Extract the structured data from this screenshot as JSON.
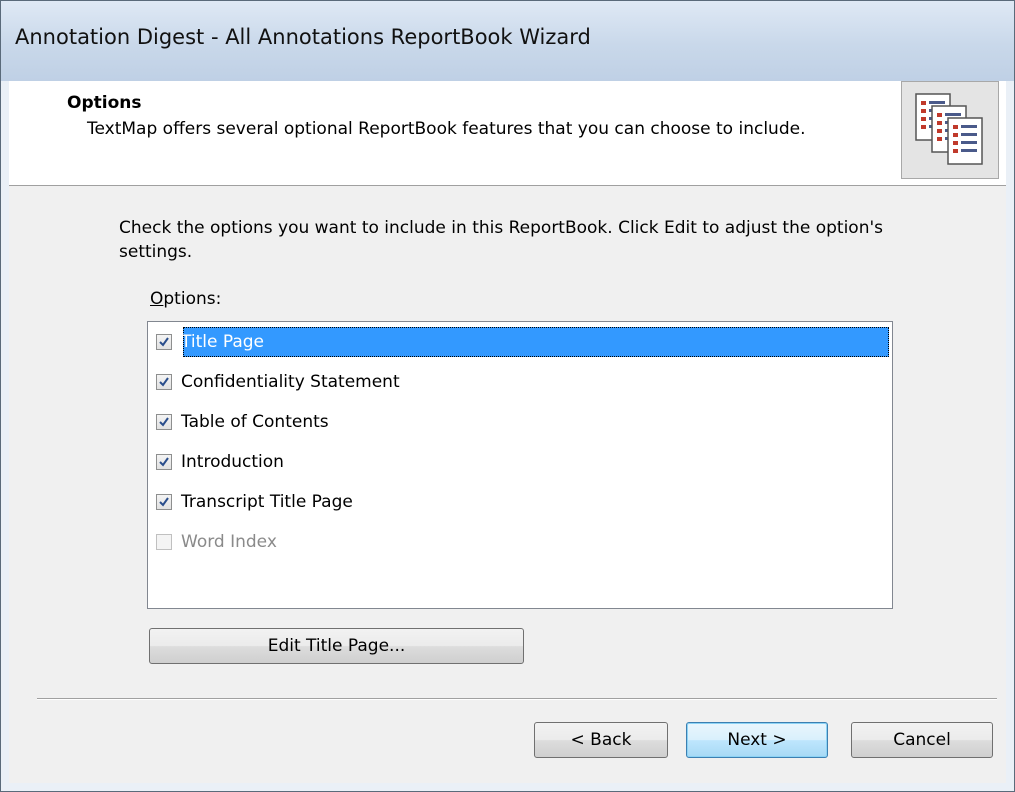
{
  "window": {
    "title": "Annotation Digest - All Annotations ReportBook Wizard"
  },
  "header": {
    "title": "Options",
    "description": "TextMap offers several optional ReportBook features that you can choose to include.",
    "icon": "reportbook-pages-icon"
  },
  "content": {
    "instructions": "Check the options you want to include in this ReportBook.  Click Edit to adjust the option's settings.",
    "options_label_accel": "O",
    "options_label_rest": "ptions:",
    "options": [
      {
        "label": "Title Page",
        "checked": true,
        "selected": true,
        "enabled": true
      },
      {
        "label": "Confidentiality Statement",
        "checked": true,
        "selected": false,
        "enabled": true
      },
      {
        "label": "Table of Contents",
        "checked": true,
        "selected": false,
        "enabled": true
      },
      {
        "label": "Introduction",
        "checked": true,
        "selected": false,
        "enabled": true
      },
      {
        "label": "Transcript Title Page",
        "checked": true,
        "selected": false,
        "enabled": true
      },
      {
        "label": "Word Index",
        "checked": false,
        "selected": false,
        "enabled": false
      }
    ],
    "edit_button_label": "Edit Title Page..."
  },
  "footer": {
    "back_label": "< Back",
    "next_label": "Next >",
    "cancel_label": "Cancel"
  },
  "colors": {
    "selection": "#3399ff",
    "check": "#2a4e8c"
  }
}
